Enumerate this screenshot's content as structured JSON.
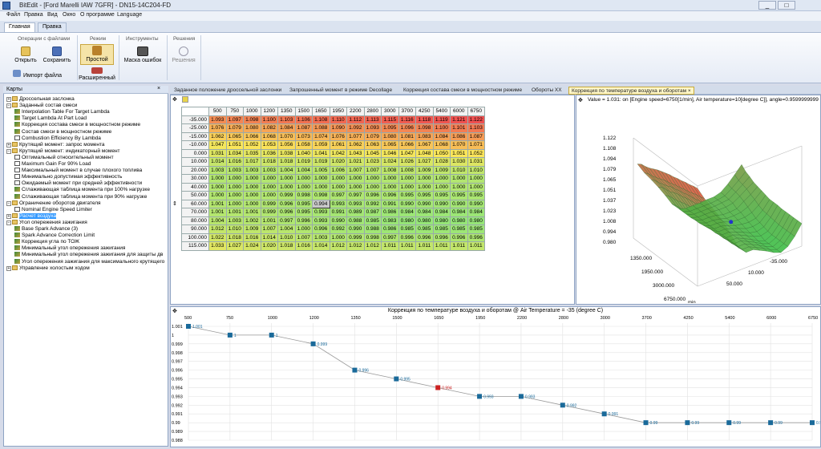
{
  "window": {
    "title": "BitEdit - [Ford Marelli IAW 7GFR] - DN15-14C204-FD",
    "controls": [
      "_",
      "□"
    ]
  },
  "menu": [
    "Файл",
    "Правка",
    "Вид",
    "Окно",
    "О программе",
    "Language"
  ],
  "ribbon": {
    "tabs": [
      "Главная",
      "Правка"
    ],
    "groups": {
      "file_ops": "Операции с файлами",
      "mode": "Режим",
      "tools": "Инструменты",
      "solutions": "Решения"
    },
    "buttons": {
      "open": "Открыть",
      "save": "Сохранить",
      "import": "Импорт файла",
      "simple": "Простой",
      "advanced": "Расширенный",
      "error_mask": "Маска ошибок",
      "solutions": "Решения"
    }
  },
  "left_panel": {
    "title": "Карты",
    "tree": [
      {
        "level": 0,
        "type": "folder",
        "label": "Дроссельная заслонка"
      },
      {
        "level": 0,
        "type": "folder",
        "label": "Заданный состав смеси",
        "open": true
      },
      {
        "level": 1,
        "type": "map",
        "label": "Interpolation Table For Target Lambda"
      },
      {
        "level": 1,
        "type": "map",
        "label": "Target Lambda At Part Load"
      },
      {
        "level": 1,
        "type": "map",
        "label": "Коррекция состава смеси в мощностном режиме"
      },
      {
        "level": 1,
        "type": "map",
        "label": "Состав смеси в мощностном режиме"
      },
      {
        "level": 1,
        "type": "table",
        "label": "Combustion Efficiency By Lambda"
      },
      {
        "level": 0,
        "type": "folder",
        "label": "Крутящий момент: запрос момента"
      },
      {
        "level": 0,
        "type": "folder",
        "label": "Крутящий момент: индикаторный момент",
        "open": true
      },
      {
        "level": 1,
        "type": "table",
        "label": "Оптимальный относительный момент"
      },
      {
        "level": 1,
        "type": "table",
        "label": "Maximum Gain For 90% Load"
      },
      {
        "level": 1,
        "type": "table",
        "label": "Максимальный момент в случае плохого топлива"
      },
      {
        "level": 1,
        "type": "table",
        "label": "Минимально допустимая эффективность"
      },
      {
        "level": 1,
        "type": "table",
        "label": "Ожидаемый момент при средней эффективности"
      },
      {
        "level": 1,
        "type": "map",
        "label": "Сглаживающая таблица момента при 100% нагрузке"
      },
      {
        "level": 1,
        "type": "map",
        "label": "Сглаживающая таблица момента при 90% нагрузке"
      },
      {
        "level": 0,
        "type": "folder",
        "label": "Ограничение оборотов двигателя",
        "open": true
      },
      {
        "level": 1,
        "type": "table",
        "label": "Nominal Engine Speed Limiter"
      },
      {
        "level": 0,
        "type": "folder",
        "label": "Расчет воздуха",
        "selected": true
      },
      {
        "level": 0,
        "type": "folder",
        "label": "Угол опережения зажигания",
        "open": true
      },
      {
        "level": 1,
        "type": "map",
        "label": "Base Spark Advance (3)"
      },
      {
        "level": 1,
        "type": "map",
        "label": "Spark Advance Correction Limit"
      },
      {
        "level": 1,
        "type": "map",
        "label": "Коррекция угла по ТОЖ"
      },
      {
        "level": 1,
        "type": "map",
        "label": "Минимальный угол опережения зажигания"
      },
      {
        "level": 1,
        "type": "map",
        "label": "Минимальный угол опережения зажигания для защиты дв"
      },
      {
        "level": 1,
        "type": "map",
        "label": "Угол опережения зажигания для максимального крутящего"
      },
      {
        "level": 0,
        "type": "folder",
        "label": "Управление холостым ходом"
      }
    ]
  },
  "doc_tabs": [
    "Заданное положение дроссельной заслонки",
    "Запрошенный момент в режиме Decollage",
    "Коррекция состава смеси в мощностном режиме",
    "Обороты XX",
    "Коррекция по температуре воздуха и оборотам"
  ],
  "table": {
    "corner": "0",
    "columns": [
      "500",
      "750",
      "1000",
      "1200",
      "1350",
      "1500",
      "1650",
      "1950",
      "2200",
      "2800",
      "3000",
      "3700",
      "4250",
      "5400",
      "6000",
      "6750"
    ],
    "rows": [
      {
        "h": "-35.000",
        "v": [
          "1.093",
          "1.097",
          "1.098",
          "1.100",
          "1.103",
          "1.106",
          "1.108",
          "1.110",
          "1.112",
          "1.113",
          "1.115",
          "1.116",
          "1.118",
          "1.119",
          "1.121",
          "1.122"
        ]
      },
      {
        "h": "-25.000",
        "v": [
          "1.076",
          "1.079",
          "1.080",
          "1.082",
          "1.084",
          "1.087",
          "1.088",
          "1.090",
          "1.092",
          "1.093",
          "1.095",
          "1.096",
          "1.098",
          "1.100",
          "1.101",
          "1.103"
        ]
      },
      {
        "h": "-15.000",
        "v": [
          "1.062",
          "1.065",
          "1.066",
          "1.068",
          "1.070",
          "1.073",
          "1.074",
          "1.076",
          "1.077",
          "1.079",
          "1.080",
          "1.081",
          "1.083",
          "1.084",
          "1.086",
          "1.087"
        ]
      },
      {
        "h": "-10.000",
        "v": [
          "1.047",
          "1.051",
          "1.052",
          "1.053",
          "1.056",
          "1.058",
          "1.059",
          "1.061",
          "1.062",
          "1.063",
          "1.065",
          "1.066",
          "1.067",
          "1.068",
          "1.070",
          "1.071"
        ]
      },
      {
        "h": "0.000",
        "v": [
          "1.031",
          "1.034",
          "1.035",
          "1.036",
          "1.038",
          "1.040",
          "1.041",
          "1.042",
          "1.043",
          "1.045",
          "1.046",
          "1.047",
          "1.048",
          "1.050",
          "1.051",
          "1.052"
        ]
      },
      {
        "h": "10.000",
        "v": [
          "1.014",
          "1.016",
          "1.017",
          "1.018",
          "1.018",
          "1.019",
          "1.019",
          "1.020",
          "1.021",
          "1.023",
          "1.024",
          "1.026",
          "1.027",
          "1.028",
          "1.030",
          "1.031"
        ]
      },
      {
        "h": "20.000",
        "v": [
          "1.003",
          "1.003",
          "1.003",
          "1.003",
          "1.004",
          "1.004",
          "1.005",
          "1.006",
          "1.007",
          "1.007",
          "1.008",
          "1.008",
          "1.009",
          "1.009",
          "1.010",
          "1.010"
        ]
      },
      {
        "h": "30.000",
        "v": [
          "1.000",
          "1.000",
          "1.000",
          "1.000",
          "1.000",
          "1.000",
          "1.000",
          "1.000",
          "1.000",
          "1.000",
          "1.000",
          "1.000",
          "1.000",
          "1.000",
          "1.000",
          "1.000"
        ]
      },
      {
        "h": "40.000",
        "v": [
          "1.000",
          "1.000",
          "1.000",
          "1.000",
          "1.000",
          "1.000",
          "1.000",
          "1.000",
          "1.000",
          "1.000",
          "1.000",
          "1.000",
          "1.000",
          "1.000",
          "1.000",
          "1.000"
        ]
      },
      {
        "h": "50.000",
        "v": [
          "1.000",
          "1.000",
          "1.000",
          "1.000",
          "0.999",
          "0.998",
          "0.998",
          "0.997",
          "0.997",
          "0.996",
          "0.996",
          "0.995",
          "0.995",
          "0.995",
          "0.995",
          "0.995"
        ]
      },
      {
        "h": "60.000",
        "v": [
          "1.001",
          "1.000",
          "1.000",
          "0.999",
          "0.996",
          "0.995",
          "0.994",
          "0.993",
          "0.993",
          "0.992",
          "0.991",
          "0.990",
          "0.990",
          "0.990",
          "0.990",
          "0.990"
        ]
      },
      {
        "h": "70.000",
        "v": [
          "1.001",
          "1.001",
          "1.001",
          "0.999",
          "0.996",
          "0.995",
          "0.993",
          "0.991",
          "0.989",
          "0.987",
          "0.986",
          "0.984",
          "0.984",
          "0.984",
          "0.984",
          "0.984"
        ]
      },
      {
        "h": "80.000",
        "v": [
          "1.004",
          "1.003",
          "1.002",
          "1.001",
          "0.997",
          "0.996",
          "0.993",
          "0.990",
          "0.988",
          "0.985",
          "0.983",
          "0.980",
          "0.980",
          "0.980",
          "0.980",
          "0.980"
        ]
      },
      {
        "h": "90.000",
        "v": [
          "1.012",
          "1.010",
          "1.009",
          "1.007",
          "1.004",
          "1.000",
          "0.996",
          "0.992",
          "0.990",
          "0.988",
          "0.986",
          "0.985",
          "0.985",
          "0.985",
          "0.985",
          "0.985"
        ]
      },
      {
        "h": "100.000",
        "v": [
          "1.022",
          "1.018",
          "1.016",
          "1.014",
          "1.010",
          "1.007",
          "1.003",
          "1.000",
          "0.999",
          "0.998",
          "0.997",
          "0.996",
          "0.996",
          "0.996",
          "0.996",
          "0.996"
        ]
      },
      {
        "h": "115.000",
        "v": [
          "1.033",
          "1.027",
          "1.024",
          "1.020",
          "1.018",
          "1.016",
          "1.014",
          "1.012",
          "1.012",
          "1.012",
          "1.011",
          "1.011",
          "1.011",
          "1.011",
          "1.011",
          "1.011"
        ]
      }
    ],
    "selected_cell": {
      "row": 10,
      "col": 6
    }
  },
  "view3d": {
    "info": "Value = 1.031: on [Engine speed=6750[1/min], Air temperature=10[degree C]], angle=0.95999999999999",
    "z_ticks": [
      "1.122",
      "1.108",
      "1.094",
      "1.079",
      "1.065",
      "1.051",
      "1.037",
      "1.023",
      "1.008",
      "0.994",
      "0.980"
    ],
    "x_ticks": [
      "1350.000",
      "1950.000",
      "3000.000",
      "6750.000"
    ],
    "y_ticks": [
      "-35.000",
      "10.000",
      "50.000"
    ],
    "x_unit": "min"
  },
  "chart_data": {
    "type": "line",
    "title": "Коррекция по температуре воздуха и оборотам @ Air Temperature = -35 (degree C)",
    "categories": [
      "500",
      "750",
      "1000",
      "1200",
      "1350",
      "1500",
      "1650",
      "1950",
      "2200",
      "2800",
      "3000",
      "3700",
      "4250",
      "5400",
      "6000",
      "6750"
    ],
    "values": [
      1.001,
      1.0,
      1.0,
      0.999,
      0.996,
      0.995,
      0.994,
      0.993,
      0.993,
      0.992,
      0.991,
      0.99,
      0.99,
      0.99,
      0.99,
      0.99
    ],
    "point_labels": [
      "1.001",
      "1",
      "1",
      "0.999",
      "0.996",
      "0.995",
      "0.994",
      "0.993",
      "0.993",
      "0.992",
      "0.991",
      "0.99",
      "0.99",
      "0.99",
      "0.99",
      "0.99"
    ],
    "highlight_index": 6,
    "y_ticks": [
      "1.001",
      "1",
      "0.999",
      "0.998",
      "0.997",
      "0.996",
      "0.995",
      "0.994",
      "0.993",
      "0.992",
      "0.991",
      "0.99",
      "0.989",
      "0.988"
    ],
    "ylim": [
      0.988,
      1.001
    ],
    "grid": true,
    "colors": {
      "point": "#1a6a9a",
      "highlight": "#cc2222",
      "line": "#999999"
    }
  }
}
